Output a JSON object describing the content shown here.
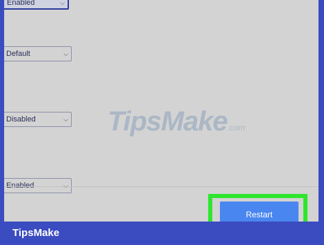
{
  "settings": {
    "top_select_value": "Enabled",
    "select_1_value": "Default",
    "select_2_value": "Disabled",
    "select_3_value": "Enabled"
  },
  "icons": {
    "dropdown": "chevron-down-icon"
  },
  "actions": {
    "restart_label": "Restart"
  },
  "watermark": {
    "main": "TipsMake",
    "suffix": ".com"
  },
  "footer": {
    "brand": "TipsMake"
  },
  "colors": {
    "highlight": "#2ee62e",
    "button": "#4a86f0",
    "frame": "#3b4bc0",
    "background": "#d3d3d3"
  }
}
